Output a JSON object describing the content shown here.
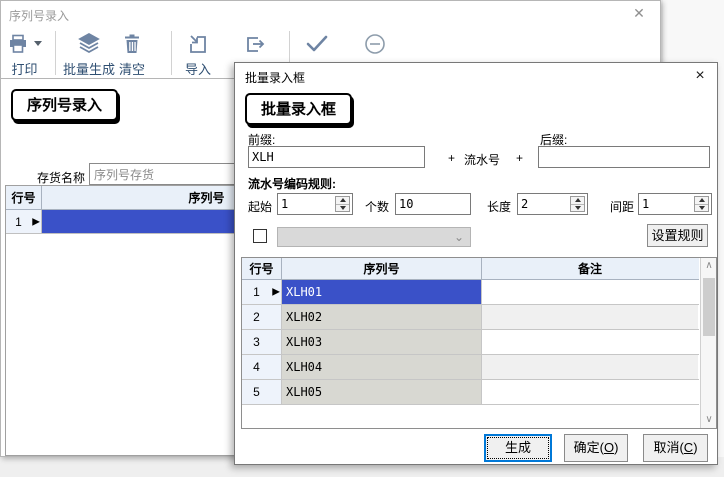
{
  "main_window": {
    "title": "序列号录入",
    "close_icon": "✕",
    "toolbar": {
      "print_label": "打印",
      "batch_generate_label": "批量生成",
      "clear_label": "清空",
      "import_label": "导入"
    },
    "tab_label": "序列号录入",
    "inventory": {
      "label": "存货名称",
      "value": "序列号存货"
    },
    "table": {
      "headers": [
        "行号",
        "序列号"
      ],
      "row_marker": "▶",
      "rows": [
        {
          "no": "1",
          "serial": ""
        }
      ]
    }
  },
  "dialog": {
    "title": "批量录入框",
    "close_icon": "×",
    "tab_label": "批量录入框",
    "prefix": {
      "label": "前缀:",
      "value": "XLH"
    },
    "plus_left": "+",
    "serial_text": "流水号",
    "plus_right": "+",
    "suffix": {
      "label": "后缀:",
      "value": ""
    },
    "rules_title": "流水号编码规则:",
    "rules": {
      "start_label": "起始",
      "start_value": "1",
      "count_label": "个数",
      "count_value": "10",
      "length_label": "长度",
      "length_value": "2",
      "gap_label": "间距",
      "gap_value": "1"
    },
    "set_rules_button": "设置规则",
    "scrollbar": {
      "up_icon": "∧",
      "down_icon": "∨"
    },
    "combo_chevron": "⌄",
    "table": {
      "headers": [
        "行号",
        "序列号",
        "备注"
      ],
      "row_marker": "▶",
      "rows": [
        {
          "no": "1",
          "serial": "XLH01",
          "note": ""
        },
        {
          "no": "2",
          "serial": "XLH02",
          "note": ""
        },
        {
          "no": "3",
          "serial": "XLH03",
          "note": ""
        },
        {
          "no": "4",
          "serial": "XLH04",
          "note": ""
        },
        {
          "no": "5",
          "serial": "XLH05",
          "note": ""
        }
      ]
    },
    "footer": {
      "generate": "生成",
      "ok_pre": "确定(",
      "ok_key": "O",
      "ok_post": ")",
      "cancel_pre": "取消(",
      "cancel_key": "C",
      "cancel_post": ")"
    }
  },
  "colors": {
    "selection_blue": "#3a51c8",
    "toolbar_icon": "#6e84a3",
    "table_header_bg": "#e9f0f9",
    "serial_cell_gray": "#d8d8d2"
  }
}
